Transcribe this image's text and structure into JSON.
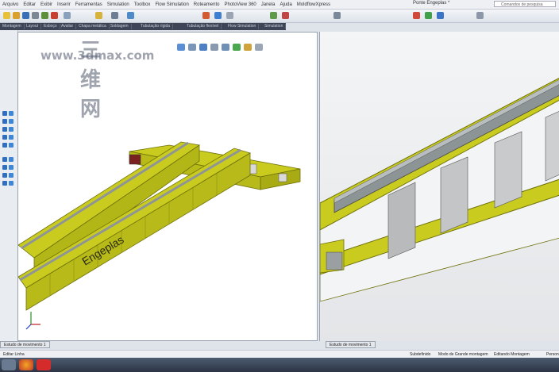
{
  "window": {
    "title": "Ponte Engeplas *",
    "search_placeholder": "Comandos de pesquisa"
  },
  "menu": [
    {
      "label": "Arquivo"
    },
    {
      "label": "Editar"
    },
    {
      "label": "Exibir"
    },
    {
      "label": "Inserir"
    },
    {
      "label": "Ferramentas"
    },
    {
      "label": "Simulation"
    },
    {
      "label": "Toolbox"
    },
    {
      "label": "Flow Simulation"
    },
    {
      "label": "Roteamento"
    },
    {
      "label": "PhotoView 360"
    },
    {
      "label": "Janela"
    },
    {
      "label": "Ajuda"
    },
    {
      "label": "MoldflowXpress"
    }
  ],
  "tabs": [
    {
      "label": "Montagem"
    },
    {
      "label": "Layout"
    },
    {
      "label": "Esboço"
    },
    {
      "label": "Avaliar"
    },
    {
      "label": "Chapa metálica"
    },
    {
      "label": "Soldagem"
    },
    {
      "label": "Tubulação rígida"
    },
    {
      "label": "Tubulação flexível"
    },
    {
      "label": "Flow Simulation"
    },
    {
      "label": "Simulation"
    }
  ],
  "watermark": {
    "cn": "三维网",
    "url": "www.3dmax.com"
  },
  "model": {
    "brand_text": "Engeplas"
  },
  "model_tabs": [
    {
      "label": "Estudo de movimento 1"
    },
    {
      "label": "Estudo de movimento 1"
    }
  ],
  "status": {
    "left": "Editar Linha",
    "state": "Subdefinido",
    "mode": "Modo de Grande montagem",
    "editing": "Editando Montagem",
    "right": "Person"
  },
  "colors": {
    "beam": "#c9cc1f",
    "beam_dark": "#7a7c0c",
    "rail": "#9aa0a3",
    "accent": "#2f6fc2"
  }
}
